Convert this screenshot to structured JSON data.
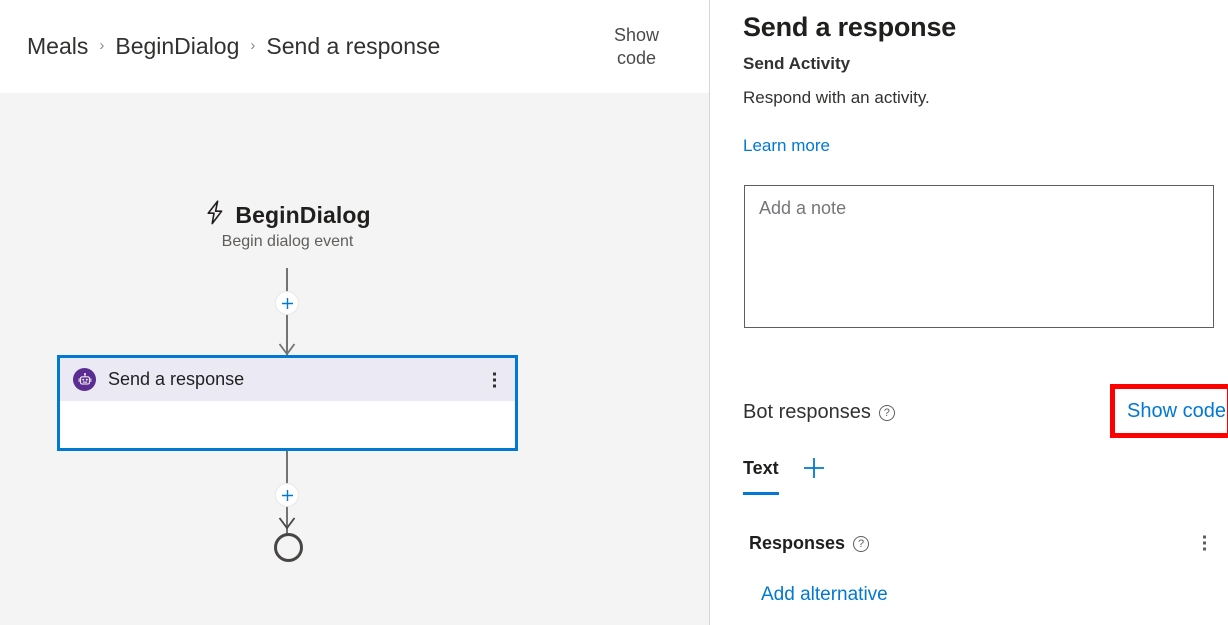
{
  "breadcrumb": {
    "items": [
      {
        "label": "Meals"
      },
      {
        "label": "BeginDialog"
      },
      {
        "label": "Send a response"
      }
    ],
    "separator": "›",
    "show_code_label": "Show\ncode"
  },
  "canvas": {
    "trigger": {
      "icon": "lightning-bolt-icon",
      "title": "BeginDialog",
      "subtitle": "Begin dialog event"
    },
    "action_card": {
      "icon": "bot-icon",
      "label": "Send a response",
      "menu_icon": "more-vertical-icon",
      "selected": true,
      "selection_color": "#0078d4",
      "header_color": "#ebe9f4",
      "icon_color": "#5c2d91"
    },
    "add_buttons": [
      {
        "name": "add-node-above",
        "glyph": "+"
      },
      {
        "name": "add-node-below",
        "glyph": "+"
      }
    ],
    "end_node": {
      "name": "end-of-flow-node"
    },
    "background_color": "#f4f4f4"
  },
  "panel": {
    "title": "Send a response",
    "subtitle": "Send Activity",
    "description": "Respond with an activity.",
    "learn_more_label": "Learn more",
    "note": {
      "placeholder": "Add a note",
      "value": ""
    },
    "bot_responses": {
      "label": "Bot responses",
      "help_glyph": "?",
      "show_code_label": "Show code",
      "highlight_color": "#ff0000"
    },
    "tabs": [
      {
        "label": "Text",
        "active": true
      }
    ],
    "add_tab_glyph": "+",
    "responses": {
      "label": "Responses",
      "help_glyph": "?",
      "menu_icon": "more-vertical-icon",
      "add_alternative_label": "Add alternative"
    },
    "link_color": "#0078d4"
  }
}
